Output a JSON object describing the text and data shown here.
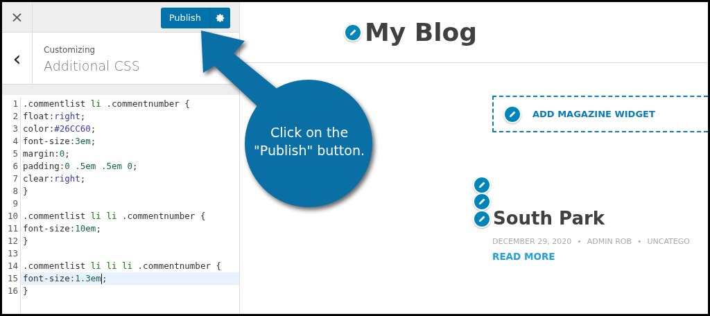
{
  "customizer": {
    "close_label": "×",
    "publish_button": "Publish",
    "back_label": "‹",
    "breadcrumb": "Customizing",
    "section_title": "Additional CSS"
  },
  "code_lines": [
    {
      "number": "1",
      "active": false,
      "tokens": [
        {
          "text": ".commentlist ",
          "kind": "plain"
        },
        {
          "text": "li",
          "kind": "tag"
        },
        {
          "text": " .commentnumber {",
          "kind": "plain"
        }
      ]
    },
    {
      "number": "2",
      "active": false,
      "tokens": [
        {
          "text": "float:",
          "kind": "plain"
        },
        {
          "text": "right",
          "kind": "keyword"
        },
        {
          "text": ";",
          "kind": "plain"
        }
      ]
    },
    {
      "number": "3",
      "active": false,
      "tokens": [
        {
          "text": "color:",
          "kind": "plain"
        },
        {
          "text": "#26CC60",
          "kind": "keyword"
        },
        {
          "text": ";",
          "kind": "plain"
        }
      ]
    },
    {
      "number": "4",
      "active": false,
      "tokens": [
        {
          "text": "font-size:",
          "kind": "plain"
        },
        {
          "text": "3em",
          "kind": "number"
        },
        {
          "text": ";",
          "kind": "plain"
        }
      ]
    },
    {
      "number": "5",
      "active": false,
      "tokens": [
        {
          "text": "margin:",
          "kind": "plain"
        },
        {
          "text": "0",
          "kind": "number"
        },
        {
          "text": ";",
          "kind": "plain"
        }
      ]
    },
    {
      "number": "6",
      "active": false,
      "tokens": [
        {
          "text": "padding:",
          "kind": "plain"
        },
        {
          "text": "0 .5em .5em 0",
          "kind": "number"
        },
        {
          "text": ";",
          "kind": "plain"
        }
      ]
    },
    {
      "number": "7",
      "active": false,
      "tokens": [
        {
          "text": "clear:",
          "kind": "plain"
        },
        {
          "text": "right",
          "kind": "keyword"
        },
        {
          "text": ";",
          "kind": "plain"
        }
      ]
    },
    {
      "number": "8",
      "active": false,
      "tokens": [
        {
          "text": "}",
          "kind": "plain"
        }
      ]
    },
    {
      "number": "9",
      "active": false
    },
    {
      "number": "10",
      "active": false,
      "tokens": [
        {
          "text": ".commentlist ",
          "kind": "plain"
        },
        {
          "text": "li li",
          "kind": "tag"
        },
        {
          "text": " .commentnumber {",
          "kind": "plain"
        }
      ]
    },
    {
      "number": "11",
      "active": false,
      "tokens": [
        {
          "text": "font-size:",
          "kind": "plain"
        },
        {
          "text": "10em",
          "kind": "number"
        },
        {
          "text": ";",
          "kind": "plain"
        }
      ]
    },
    {
      "number": "12",
      "active": false,
      "tokens": [
        {
          "text": "}",
          "kind": "plain"
        }
      ]
    },
    {
      "number": "13",
      "active": false
    },
    {
      "number": "14",
      "active": false,
      "tokens": [
        {
          "text": ".commentlist ",
          "kind": "plain"
        },
        {
          "text": "li li li",
          "kind": "tag"
        },
        {
          "text": " .commentnumber {",
          "kind": "plain"
        }
      ]
    },
    {
      "number": "15",
      "active": true,
      "tokens": [
        {
          "text": "font-size:",
          "kind": "plain"
        },
        {
          "text": "1.3em",
          "kind": "number"
        },
        {
          "text": ";",
          "kind": "plain"
        }
      ]
    },
    {
      "number": "16",
      "active": false,
      "tokens": [
        {
          "text": "}",
          "kind": "plain"
        }
      ]
    }
  ],
  "preview": {
    "site_title": "My Blog",
    "widget_button": "ADD MAGAZINE WIDGET",
    "post": {
      "title": "South Park",
      "meta": [
        "DECEMBER 29, 2020",
        "ADMIN ROB",
        "UNCATEGO"
      ],
      "meta_separator": "•",
      "read_more": "READ MORE"
    }
  },
  "callout": {
    "text": "Click on the \"Publish\" button."
  }
}
